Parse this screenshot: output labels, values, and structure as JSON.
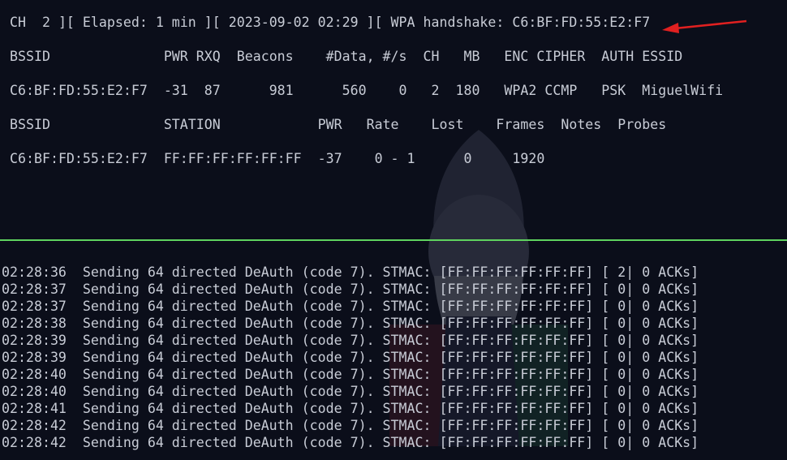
{
  "status_line": "CH  2 ][ Elapsed: 1 min ][ 2023-09-02 02:29 ][ WPA handshake: C6:BF:FD:55:E2:F7",
  "ap_header": "BSSID              PWR RXQ  Beacons    #Data, #/s  CH   MB   ENC CIPHER  AUTH ESSID",
  "ap_row": "C6:BF:FD:55:E2:F7  -31  87      981      560    0   2  180   WPA2 CCMP   PSK  MiguelWifi",
  "station_header": "BSSID              STATION            PWR   Rate    Lost    Frames  Notes  Probes",
  "station_row": "C6:BF:FD:55:E2:F7  FF:FF:FF:FF:FF:FF  -37    0 - 1      0     1920",
  "log": [
    "02:28:36  Sending 64 directed DeAuth (code 7). STMAC: [FF:FF:FF:FF:FF:FF] [ 2| 0 ACKs]",
    "02:28:37  Sending 64 directed DeAuth (code 7). STMAC: [FF:FF:FF:FF:FF:FF] [ 0| 0 ACKs]",
    "02:28:37  Sending 64 directed DeAuth (code 7). STMAC: [FF:FF:FF:FF:FF:FF] [ 0| 0 ACKs]",
    "02:28:38  Sending 64 directed DeAuth (code 7). STMAC: [FF:FF:FF:FF:FF:FF] [ 0| 0 ACKs]",
    "02:28:39  Sending 64 directed DeAuth (code 7). STMAC: [FF:FF:FF:FF:FF:FF] [ 0| 0 ACKs]",
    "02:28:39  Sending 64 directed DeAuth (code 7). STMAC: [FF:FF:FF:FF:FF:FF] [ 0| 0 ACKs]",
    "02:28:40  Sending 64 directed DeAuth (code 7). STMAC: [FF:FF:FF:FF:FF:FF] [ 0| 0 ACKs]",
    "02:28:40  Sending 64 directed DeAuth (code 7). STMAC: [FF:FF:FF:FF:FF:FF] [ 0| 0 ACKs]",
    "02:28:41  Sending 64 directed DeAuth (code 7). STMAC: [FF:FF:FF:FF:FF:FF] [ 0| 0 ACKs]",
    "02:28:42  Sending 64 directed DeAuth (code 7). STMAC: [FF:FF:FF:FF:FF:FF] [ 0| 0 ACKs]",
    "02:28:42  Sending 64 directed DeAuth (code 7). STMAC: [FF:FF:FF:FF:FF:FF] [ 0| 0 ACKs]"
  ],
  "colors": {
    "background": "#0b0e1a",
    "text": "#c8ccd6",
    "divider": "#5fd35f",
    "arrow": "#e02020"
  },
  "icons": {
    "annotation": "arrow-left-icon",
    "background_art": "wizard-watermark-icon"
  }
}
